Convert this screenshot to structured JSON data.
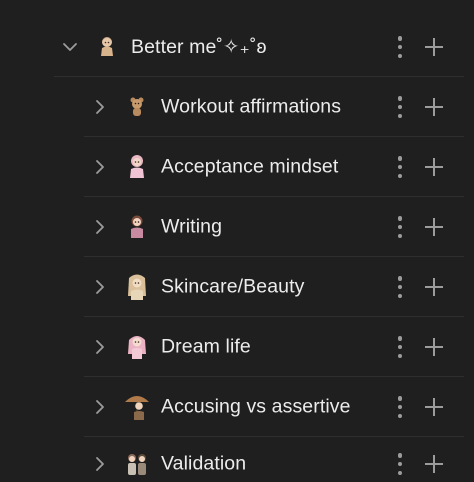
{
  "parent": {
    "label": "Better me˚✧₊˚ʚ",
    "expanded": true,
    "icon": "chevron-down-icon"
  },
  "children": [
    {
      "label": "Workout affirmations",
      "emoji": "teddy-emoji"
    },
    {
      "label": "Acceptance mindset",
      "emoji": "pink-doll-emoji"
    },
    {
      "label": "Writing",
      "emoji": "writing-doll-emoji"
    },
    {
      "label": "Skincare/Beauty",
      "emoji": "beige-doll-emoji"
    },
    {
      "label": "Dream life",
      "emoji": "pink-hair-doll-emoji"
    },
    {
      "label": "Accusing vs assertive",
      "emoji": "umbrella-doll-emoji"
    },
    {
      "label": "Validation",
      "emoji": "two-dolls-emoji"
    }
  ],
  "colors": {
    "background": "#1f1f1f",
    "text": "#ececec",
    "icon": "#9c9c9c",
    "separator": "#2f2f2f"
  }
}
